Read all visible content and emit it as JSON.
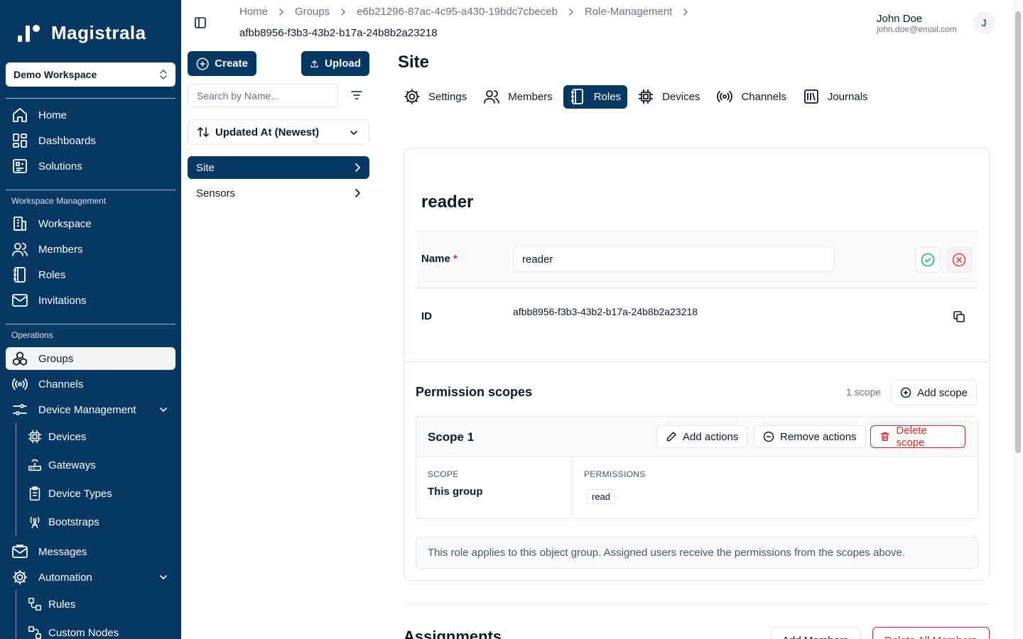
{
  "app": {
    "name": "Magistrala"
  },
  "sidebar": {
    "workspace": "Demo Workspace",
    "top_items": [
      {
        "label": "Home",
        "icon": "home-icon"
      },
      {
        "label": "Dashboards",
        "icon": "dashboard-icon"
      },
      {
        "label": "Solutions",
        "icon": "solutions-icon"
      }
    ],
    "workspace_section": "Workspace Management",
    "workspace_items": [
      {
        "label": "Workspace",
        "icon": "building-icon"
      },
      {
        "label": "Members",
        "icon": "users-icon"
      },
      {
        "label": "Roles",
        "icon": "book-icon"
      },
      {
        "label": "Invitations",
        "icon": "mail-icon"
      }
    ],
    "operations_section": "Operations",
    "operations_items": [
      {
        "label": "Groups",
        "icon": "groups-icon",
        "active": true
      },
      {
        "label": "Channels",
        "icon": "broadcast-icon"
      },
      {
        "label": "Device Management",
        "icon": "sliders-icon"
      }
    ],
    "device_sub": [
      {
        "label": "Devices",
        "icon": "chip-icon"
      },
      {
        "label": "Gateways",
        "icon": "router-icon"
      },
      {
        "label": "Device Types",
        "icon": "clipboard-icon"
      },
      {
        "label": "Bootstraps",
        "icon": "antenna-icon"
      }
    ],
    "messages": "Messages",
    "automation": "Automation",
    "automation_sub": [
      {
        "label": "Rules",
        "icon": "workflow-icon"
      },
      {
        "label": "Custom Nodes",
        "icon": "nodes-icon"
      }
    ]
  },
  "header": {
    "breadcrumbs": [
      "Home",
      "Groups",
      "e6b21296-87ac-4c95-a430-19bdc7cbeceb",
      "Role-Management"
    ],
    "current": "afbb8956-f3b3-43b2-b17a-24b8b2a23218",
    "user_name": "John Doe",
    "user_email": "john.doe@email.com",
    "avatar_initial": "J"
  },
  "list_panel": {
    "create_label": "Create",
    "upload_label": "Upload",
    "search_placeholder": "Search by Name...",
    "sort_label": "Updated At (Newest)",
    "items": [
      {
        "label": "Site",
        "active": true
      },
      {
        "label": "Sensors",
        "active": false
      }
    ]
  },
  "main": {
    "title": "Site",
    "tabs": [
      {
        "label": "Settings",
        "icon": "gear-icon"
      },
      {
        "label": "Members",
        "icon": "users-icon"
      },
      {
        "label": "Roles",
        "icon": "book-icon",
        "active": true
      },
      {
        "label": "Devices",
        "icon": "chip-icon"
      },
      {
        "label": "Channels",
        "icon": "broadcast-icon"
      },
      {
        "label": "Journals",
        "icon": "library-icon"
      }
    ],
    "role": {
      "heading": "reader",
      "name_label": "Name",
      "required_mark": "*",
      "name_value": "reader",
      "id_label": "ID",
      "id_value": "afbb8956-f3b3-43b2-b17a-24b8b2a23218"
    },
    "permissions": {
      "title": "Permission scopes",
      "count": "1 scope",
      "add_scope_label": "Add scope",
      "scope": {
        "name": "Scope 1",
        "add_actions_label": "Add actions",
        "remove_actions_label": "Remove actions",
        "delete_label": "Delete scope",
        "scope_col_label": "SCOPE",
        "scope_value": "This group",
        "perm_col_label": "PERMISSIONS",
        "permissions": [
          "read"
        ]
      },
      "note": "This role applies to this object group. Assigned users receive the permissions from the scopes above."
    },
    "assignments": {
      "title": "Assignments",
      "add_members_label": "Add Members",
      "delete_all_label": "Delete All Members"
    }
  },
  "colors": {
    "primary": "#073763",
    "danger": "#dc2626",
    "success": "#10b981"
  }
}
